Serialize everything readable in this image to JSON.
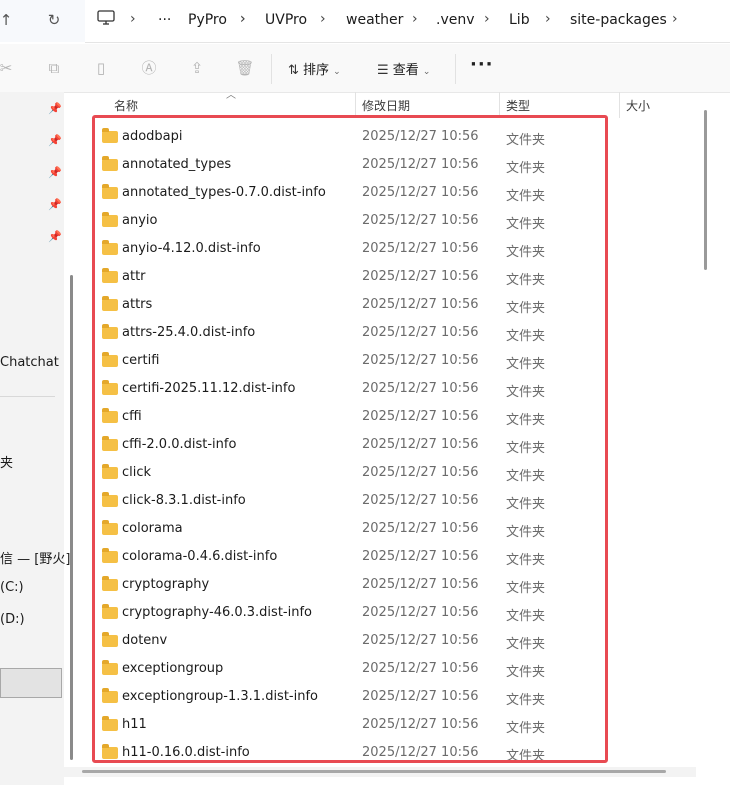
{
  "breadcrumb": [
    "PyPro",
    "UVPro",
    "weather",
    ".venv",
    "Lib",
    "site-packages"
  ],
  "overflow_label": "···",
  "toolbar": {
    "sort_label": "排序",
    "view_label": "查看",
    "more_label": "···"
  },
  "navpane": {
    "chatchat": "Chatchat",
    "item_folder": "夹",
    "item_wildfire": "信 — [野火]",
    "drive_c": "(C:)",
    "drive_d": "(D:)"
  },
  "columns": {
    "name": "名称",
    "date": "修改日期",
    "type": "类型",
    "size": "大小"
  },
  "files": [
    {
      "name": "adodbapi",
      "date": "2025/12/27 10:56",
      "type": "文件夹"
    },
    {
      "name": "annotated_types",
      "date": "2025/12/27 10:56",
      "type": "文件夹"
    },
    {
      "name": "annotated_types-0.7.0.dist-info",
      "date": "2025/12/27 10:56",
      "type": "文件夹"
    },
    {
      "name": "anyio",
      "date": "2025/12/27 10:56",
      "type": "文件夹"
    },
    {
      "name": "anyio-4.12.0.dist-info",
      "date": "2025/12/27 10:56",
      "type": "文件夹"
    },
    {
      "name": "attr",
      "date": "2025/12/27 10:56",
      "type": "文件夹"
    },
    {
      "name": "attrs",
      "date": "2025/12/27 10:56",
      "type": "文件夹"
    },
    {
      "name": "attrs-25.4.0.dist-info",
      "date": "2025/12/27 10:56",
      "type": "文件夹"
    },
    {
      "name": "certifi",
      "date": "2025/12/27 10:56",
      "type": "文件夹"
    },
    {
      "name": "certifi-2025.11.12.dist-info",
      "date": "2025/12/27 10:56",
      "type": "文件夹"
    },
    {
      "name": "cffi",
      "date": "2025/12/27 10:56",
      "type": "文件夹"
    },
    {
      "name": "cffi-2.0.0.dist-info",
      "date": "2025/12/27 10:56",
      "type": "文件夹"
    },
    {
      "name": "click",
      "date": "2025/12/27 10:56",
      "type": "文件夹"
    },
    {
      "name": "click-8.3.1.dist-info",
      "date": "2025/12/27 10:56",
      "type": "文件夹"
    },
    {
      "name": "colorama",
      "date": "2025/12/27 10:56",
      "type": "文件夹"
    },
    {
      "name": "colorama-0.4.6.dist-info",
      "date": "2025/12/27 10:56",
      "type": "文件夹"
    },
    {
      "name": "cryptography",
      "date": "2025/12/27 10:56",
      "type": "文件夹"
    },
    {
      "name": "cryptography-46.0.3.dist-info",
      "date": "2025/12/27 10:56",
      "type": "文件夹"
    },
    {
      "name": "dotenv",
      "date": "2025/12/27 10:56",
      "type": "文件夹"
    },
    {
      "name": "exceptiongroup",
      "date": "2025/12/27 10:56",
      "type": "文件夹"
    },
    {
      "name": "exceptiongroup-1.3.1.dist-info",
      "date": "2025/12/27 10:56",
      "type": "文件夹"
    },
    {
      "name": "h11",
      "date": "2025/12/27 10:56",
      "type": "文件夹"
    },
    {
      "name": "h11-0.16.0.dist-info",
      "date": "2025/12/27 10:56",
      "type": "文件夹"
    }
  ],
  "colors": {
    "highlight": "#e84a52",
    "folder": "#f5c045"
  }
}
